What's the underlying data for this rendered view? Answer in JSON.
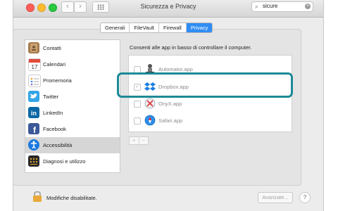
{
  "window": {
    "title": "Sicurezza e Privacy"
  },
  "toolbar": {
    "back_label": "‹",
    "forward_label": "›"
  },
  "search": {
    "value": "sicure",
    "clear_label": "×"
  },
  "tabs": [
    {
      "label": "Generali",
      "active": false
    },
    {
      "label": "FileVault",
      "active": false
    },
    {
      "label": "Firewall",
      "active": false
    },
    {
      "label": "Privacy",
      "active": true
    }
  ],
  "sidebar": {
    "items": [
      {
        "label": "Contatti",
        "icon": "contacts-icon",
        "selected": false
      },
      {
        "label": "Calendari",
        "icon": "calendar-icon",
        "selected": false
      },
      {
        "label": "Promemoria",
        "icon": "reminders-icon",
        "selected": false
      },
      {
        "label": "Twitter",
        "icon": "twitter-icon",
        "selected": false
      },
      {
        "label": "LinkedIn",
        "icon": "linkedin-icon",
        "selected": false
      },
      {
        "label": "Facebook",
        "icon": "facebook-icon",
        "selected": false
      },
      {
        "label": "Accessibilità",
        "icon": "accessibility-icon",
        "selected": true
      },
      {
        "label": "Diagnosi e utilizzo",
        "icon": "diagnostics-icon",
        "selected": false
      }
    ]
  },
  "main": {
    "description": "Consenti alle app in basso di controllare il computer.",
    "apps": [
      {
        "label": "Automator.app",
        "checked": false
      },
      {
        "label": "Dropbox.app",
        "checked": true
      },
      {
        "label": "OnyX.app",
        "checked": false
      },
      {
        "label": "Safari.app",
        "checked": false
      }
    ],
    "add_label": "+",
    "remove_label": "−"
  },
  "footer": {
    "lock_label": "Modifiche disabilitate.",
    "advanced_label": "Avanzate...",
    "help_label": "?"
  },
  "colors": {
    "accent": "#2f8df4",
    "highlight": "#1c8a97"
  }
}
